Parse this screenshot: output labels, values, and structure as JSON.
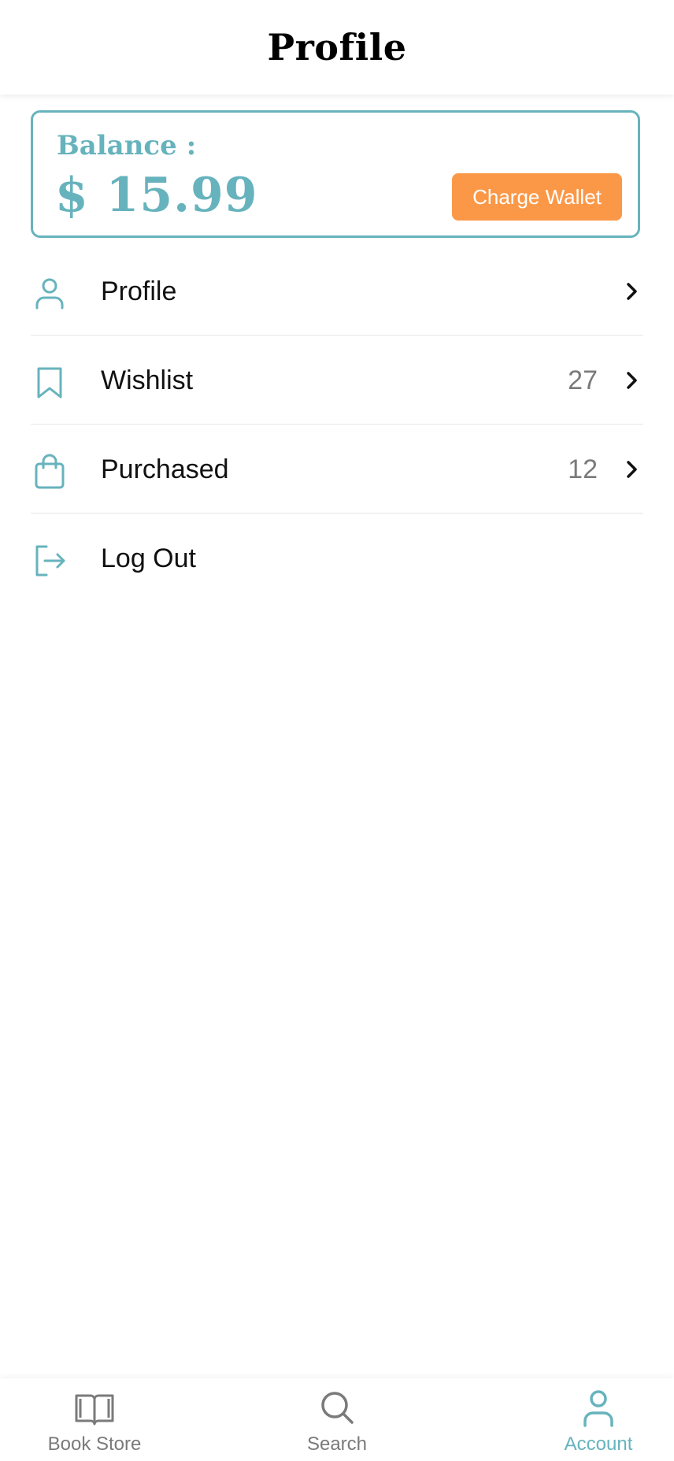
{
  "header": {
    "title": "Profile"
  },
  "balance": {
    "label": "Balance :",
    "amount": "$ 15.99",
    "charge_label": "Charge Wallet"
  },
  "menu": {
    "items": [
      {
        "label": "Profile",
        "count": "",
        "icon": "user-icon"
      },
      {
        "label": "Wishlist",
        "count": "27",
        "icon": "bookmark-icon"
      },
      {
        "label": "Purchased",
        "count": "12",
        "icon": "shopping-bag-icon"
      },
      {
        "label": "Log Out",
        "count": "",
        "icon": "logout-icon"
      }
    ]
  },
  "tabbar": {
    "tabs": [
      {
        "label": "Book Store",
        "icon": "open-book-icon",
        "active": false
      },
      {
        "label": "Search",
        "icon": "search-icon",
        "active": false
      },
      {
        "label": "Account",
        "icon": "user-icon",
        "active": true
      }
    ]
  },
  "colors": {
    "accent": "#67b3bd",
    "button": "#fb9847",
    "muted": "#7a7a7a"
  }
}
